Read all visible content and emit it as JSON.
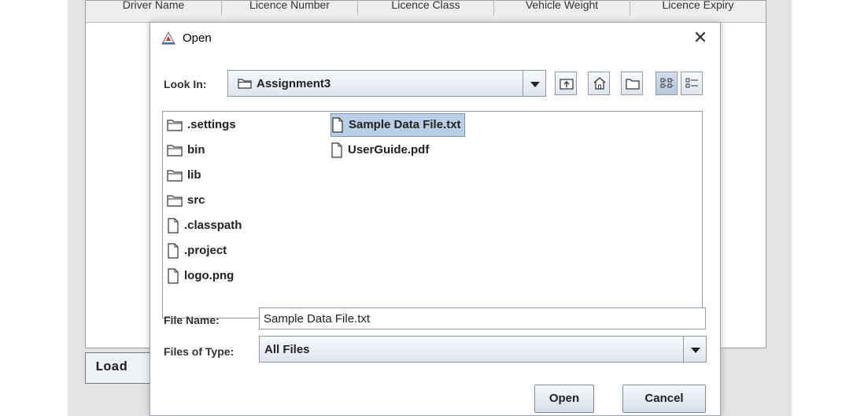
{
  "background": {
    "columns": [
      "Driver Name",
      "Licence Number",
      "Licence Class",
      "Vehicle Weight",
      "Licence Expiry"
    ],
    "load_label": "Load"
  },
  "dialog": {
    "title": "Open",
    "close_glyph": "✕",
    "look_in_label": "Look In:",
    "look_in_value": "Assignment3",
    "files_col1": [
      {
        "name": ".settings",
        "icon": "folder-icon"
      },
      {
        "name": "bin",
        "icon": "folder-icon"
      },
      {
        "name": "lib",
        "icon": "folder-icon"
      },
      {
        "name": "src",
        "icon": "folder-icon"
      },
      {
        "name": ".classpath",
        "icon": "file-icon"
      },
      {
        "name": ".project",
        "icon": "file-icon"
      },
      {
        "name": "logo.png",
        "icon": "file-icon"
      }
    ],
    "files_col2": [
      {
        "name": "Sample Data File.txt",
        "icon": "file-icon",
        "selected": true
      },
      {
        "name": "UserGuide.pdf",
        "icon": "file-icon"
      }
    ],
    "file_name_label": "File Name:",
    "file_name_value": "Sample Data File.txt",
    "files_of_type_label": "Files of Type:",
    "files_of_type_value": "All Files",
    "open_button": "Open",
    "cancel_button": "Cancel"
  },
  "colors": {
    "selection": "#b8cfe5",
    "border": "#8e9aa8"
  }
}
